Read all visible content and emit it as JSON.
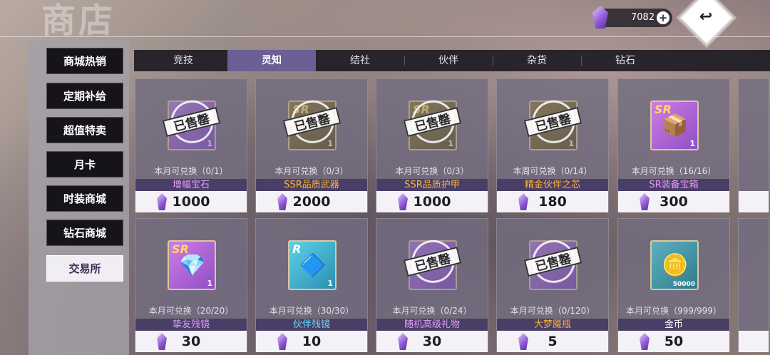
{
  "header": {
    "title": "商店",
    "currency_amount": "7082",
    "currency_icon": "crystal-icon",
    "plus_icon": "plus-icon",
    "back_icon": "return-arrow-icon",
    "back_glyph": "↩"
  },
  "sidebar": {
    "items": [
      {
        "label": "商城热销"
      },
      {
        "label": "定期补给"
      },
      {
        "label": "超值特卖"
      },
      {
        "label": "月卡"
      },
      {
        "label": "时装商城"
      },
      {
        "label": "钻石商城"
      },
      {
        "label": "交易所",
        "active": true
      }
    ]
  },
  "tabs": [
    {
      "label": "竞技"
    },
    {
      "label": "灵知",
      "active": true
    },
    {
      "label": "结社"
    },
    {
      "label": "伙伴"
    },
    {
      "label": "杂货"
    },
    {
      "label": "钻石"
    }
  ],
  "stamp_text": "已售罄",
  "items": [
    {
      "name": "增幅宝石",
      "limit": "本月可兑换（0/1）",
      "price": "1000",
      "count": "1",
      "sold_out": true
    },
    {
      "name": "SSR品质武器",
      "limit": "本月可兑换（0/3）",
      "price": "2000",
      "count": "1",
      "sold_out": true
    },
    {
      "name": "SSR品质护甲",
      "limit": "本月可兑换（0/3）",
      "price": "1000",
      "count": "1",
      "sold_out": true
    },
    {
      "name": "精金伙伴之芯",
      "limit": "本周可兑换（0/14）",
      "price": "180",
      "count": "1",
      "sold_out": true
    },
    {
      "name": "SR装备宝箱",
      "limit": "本月可兑换（16/16）",
      "price": "300",
      "count": "1",
      "sold_out": false,
      "badge": "SR"
    },
    {
      "name": "挚友残镜",
      "limit": "本月可兑换（20/20）",
      "price": "30",
      "count": "1",
      "sold_out": false,
      "badge": "SR"
    },
    {
      "name": "伙伴残镜",
      "limit": "本月可兑换（30/30）",
      "price": "10",
      "count": "1",
      "sold_out": false,
      "badge": "R"
    },
    {
      "name": "随机高级礼物",
      "limit": "本月可兑换（0/24）",
      "price": "30",
      "count": "",
      "sold_out": true
    },
    {
      "name": "大梦魇瓶",
      "limit": "本月可兑换（0/120）",
      "price": "5",
      "count": "",
      "sold_out": true
    },
    {
      "name": "金币",
      "limit": "本月可兑换（999/999）",
      "price": "50",
      "count": "50000",
      "sold_out": false
    }
  ]
}
